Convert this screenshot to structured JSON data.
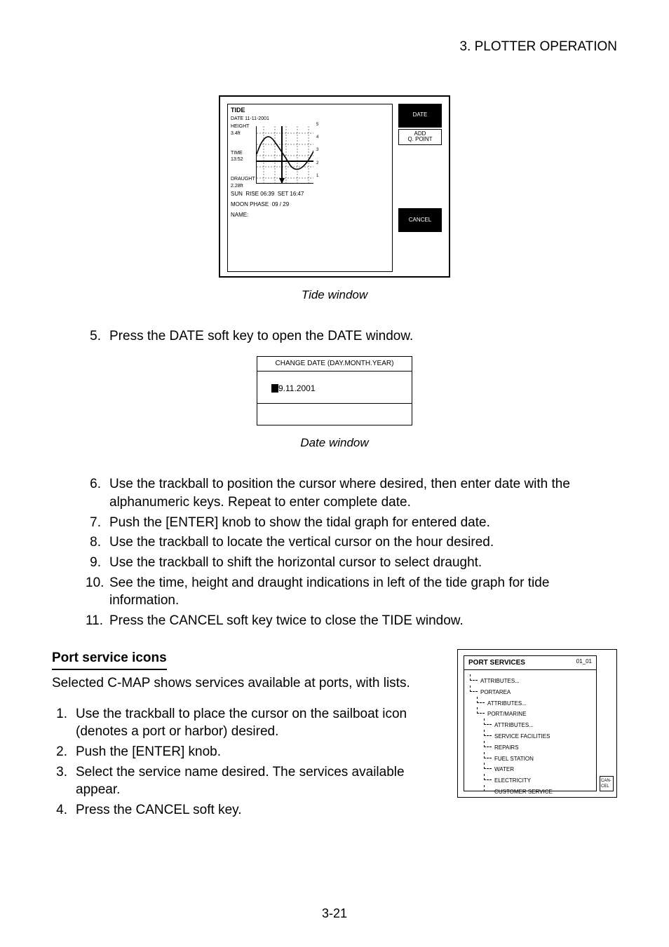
{
  "header": "3. PLOTTER OPERATION",
  "tide": {
    "title": "TIDE",
    "date_lbl": "DATE",
    "date_val": "11-11-2001",
    "left": {
      "height_lbl": "HEIGHT",
      "height_val": "3.4ft",
      "time_lbl": "TIME",
      "time_val": "13:52",
      "draught_lbl": "DRAUGHT",
      "draught_val": "2.28ft",
      "sun_lbl": "SUN",
      "rise_lbl": "RISE",
      "rise_val": "06:39",
      "set_lbl": "SET",
      "set_val": "16:47",
      "moon_lbl": "MOON PHASE",
      "moon_val": "09 / 29"
    },
    "softkeys": {
      "date": "DATE",
      "add": "ADD\nQ. POINT",
      "cancel": "CANCEL"
    },
    "caption": "NAME:",
    "figcap": "Tide window"
  },
  "list": {
    "i5": {
      "n": "5.",
      "t": "Press the DATE soft key to open the DATE window."
    },
    "i6": {
      "n": "6.",
      "t": "Use the trackball to position the cursor where desired, then enter date with the alphanumeric keys. Repeat to enter complete date."
    },
    "i7": {
      "n": "7.",
      "t": "Push the [ENTER] knob to show the tidal graph for entered date."
    },
    "i8": {
      "n": "8.",
      "t": "Use the trackball to locate the vertical cursor on the hour desired."
    },
    "i9": {
      "n": "9.",
      "t": "Use the trackball to shift the horizontal cursor to select draught."
    },
    "i10": {
      "n": "10.",
      "t": "See the time, height and draught indications in left of the tide graph for tide information."
    },
    "i11": {
      "n": "11.",
      "t": "Press the CANCEL soft key twice to close the TIDE window."
    }
  },
  "date": {
    "title": "CHANGE DATE (DAY.MONTH.YEAR)",
    "val": "9.11.2001",
    "figcap": "Date window"
  },
  "port": {
    "heading": "Port service icons",
    "intro": "Selected C-MAP shows services available at ports, with lists.",
    "steps": {
      "s1": {
        "n": "1.",
        "t": "Use the trackball to place the cursor on the sailboat icon (denotes a port or harbor) desired."
      },
      "s2": {
        "n": "2.",
        "t": "Push the [ENTER] knob."
      },
      "s3": {
        "n": "3.",
        "t": "Select the service name desired. The services available appear."
      },
      "s4": {
        "n": "4.",
        "t": "Press the CANCEL soft key."
      }
    },
    "fig": {
      "title": "PORT SERVICES",
      "date": "01_01",
      "tree": {
        "a": "ATTRIBUTES...",
        "b": "PORTAREA",
        "c": "ATTRIBUTES...",
        "d": "PORT/MARINE",
        "e": "ATTRIBUTES...",
        "f": "SERVICE FACILITIES",
        "g": "REPAIRS",
        "h": "FUEL STATION",
        "i": "WATER",
        "j": "ELECTRICITY",
        "k": "CUSTOMER SERVICE"
      },
      "cancel": "CAN-\nCEL"
    }
  },
  "pagenum": "3-21"
}
